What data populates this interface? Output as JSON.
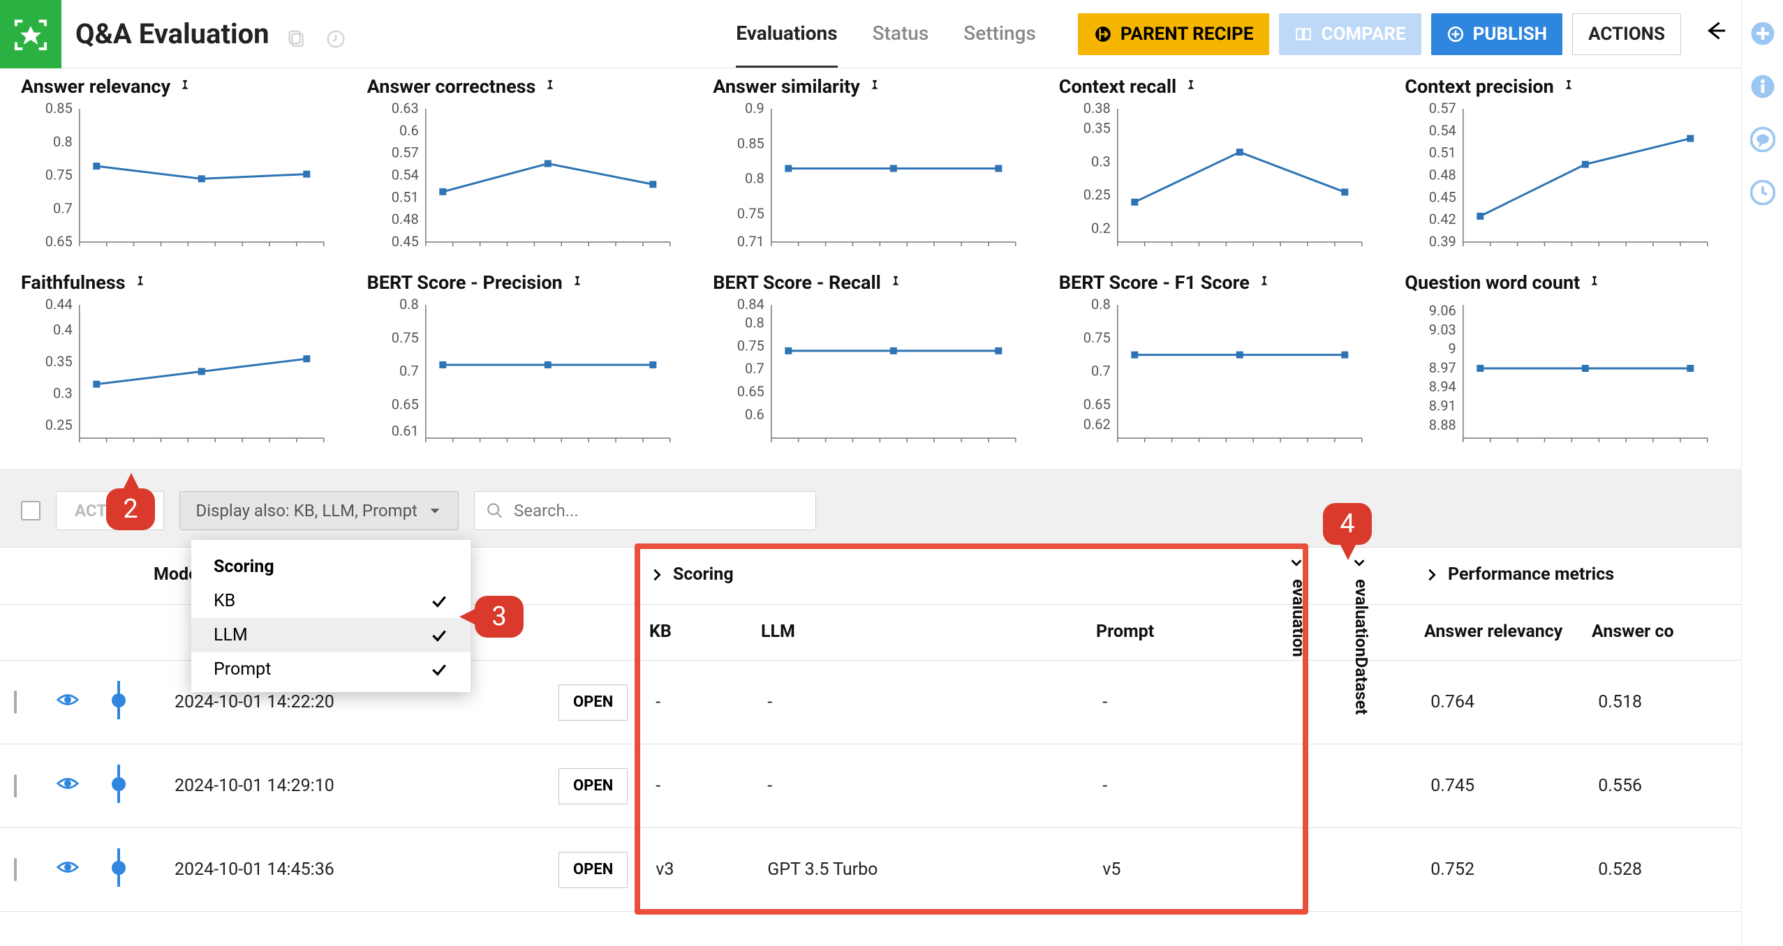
{
  "header": {
    "title": "Q&A Evaluation",
    "tabs": [
      "Evaluations",
      "Status",
      "Settings"
    ],
    "active_tab": 0,
    "btn_parent": "PARENT RECIPE",
    "btn_compare": "COMPARE",
    "btn_publish": "PUBLISH",
    "btn_actions": "ACTIONS"
  },
  "chart_data": [
    {
      "title": "Answer relevancy",
      "type": "line",
      "ylim": [
        0.65,
        0.85
      ],
      "yticks": [
        0.65,
        0.7,
        0.75,
        0.8,
        0.85
      ],
      "values": [
        0.764,
        0.745,
        0.752
      ]
    },
    {
      "title": "Answer correctness",
      "type": "line",
      "ylim": [
        0.45,
        0.63
      ],
      "yticks": [
        0.45,
        0.48,
        0.51,
        0.54,
        0.57,
        0.6,
        0.63
      ],
      "values": [
        0.518,
        0.556,
        0.528
      ]
    },
    {
      "title": "Answer similarity",
      "type": "line",
      "ylim": [
        0.71,
        0.9
      ],
      "yticks": [
        0.71,
        0.75,
        0.8,
        0.85,
        0.9
      ],
      "values": [
        0.815,
        0.815,
        0.815
      ]
    },
    {
      "title": "Context recall",
      "type": "line",
      "ylim": [
        0.18,
        0.38
      ],
      "yticks": [
        0.2,
        0.25,
        0.3,
        0.35,
        0.38
      ],
      "values": [
        0.24,
        0.315,
        0.255
      ]
    },
    {
      "title": "Context precision",
      "type": "line",
      "ylim": [
        0.39,
        0.57
      ],
      "yticks": [
        0.39,
        0.42,
        0.45,
        0.48,
        0.51,
        0.54,
        0.57
      ],
      "values": [
        0.425,
        0.495,
        0.53
      ]
    },
    {
      "title": "Faithfulness",
      "type": "line",
      "ylim": [
        0.23,
        0.44
      ],
      "yticks": [
        0.25,
        0.3,
        0.35,
        0.4,
        0.44
      ],
      "values": [
        0.315,
        0.335,
        0.355
      ]
    },
    {
      "title": "BERT Score - Precision",
      "type": "line",
      "ylim": [
        0.6,
        0.8
      ],
      "yticks": [
        0.61,
        0.65,
        0.7,
        0.75,
        0.8
      ],
      "values": [
        0.71,
        0.71,
        0.71
      ]
    },
    {
      "title": "BERT Score - Recall",
      "type": "line",
      "ylim": [
        0.55,
        0.84
      ],
      "yticks": [
        0.6,
        0.65,
        0.7,
        0.75,
        0.8,
        0.84
      ],
      "values": [
        0.74,
        0.74,
        0.74
      ]
    },
    {
      "title": "BERT Score - F1 Score",
      "type": "line",
      "ylim": [
        0.6,
        0.8
      ],
      "yticks": [
        0.62,
        0.65,
        0.7,
        0.75,
        0.8
      ],
      "values": [
        0.725,
        0.725,
        0.725
      ]
    },
    {
      "title": "Question word count",
      "type": "line",
      "ylim": [
        8.86,
        9.07
      ],
      "yticks": [
        8.88,
        8.91,
        8.94,
        8.97,
        9,
        9.03,
        9.06
      ],
      "values": [
        8.97,
        8.97,
        8.97
      ]
    }
  ],
  "toolbar": {
    "actions": "ACTIONS",
    "display_also": "Display also: KB, LLM, Prompt",
    "search_placeholder": "Search..."
  },
  "dropdown": {
    "heading": "Scoring",
    "items": [
      {
        "label": "KB",
        "checked": true
      },
      {
        "label": "LLM",
        "checked": true
      },
      {
        "label": "Prompt",
        "checked": true
      }
    ]
  },
  "table": {
    "model_eval_header": "Model Evaluation",
    "scoring_header": "Scoring",
    "perf_header": "Performance metrics",
    "sub_headers": {
      "kb": "KB",
      "llm": "LLM",
      "prompt": "Prompt",
      "ar": "Answer relevancy",
      "ac": "Answer co"
    },
    "vcols": {
      "evaluation": "evaluation",
      "evaluationDataset": "evaluationDataset"
    },
    "open_label": "OPEN",
    "rows": [
      {
        "ts": "2024-10-01 14:22:20",
        "kb": "-",
        "llm": "-",
        "prompt": "-",
        "ar": "0.764",
        "ac": "0.518"
      },
      {
        "ts": "2024-10-01 14:29:10",
        "kb": "-",
        "llm": "-",
        "prompt": "-",
        "ar": "0.745",
        "ac": "0.556"
      },
      {
        "ts": "2024-10-01 14:45:36",
        "kb": "v3",
        "llm": "GPT 3.5 Turbo",
        "prompt": "v5",
        "ar": "0.752",
        "ac": "0.528"
      }
    ]
  },
  "callouts": {
    "c2": "2",
    "c3": "3",
    "c4": "4"
  }
}
